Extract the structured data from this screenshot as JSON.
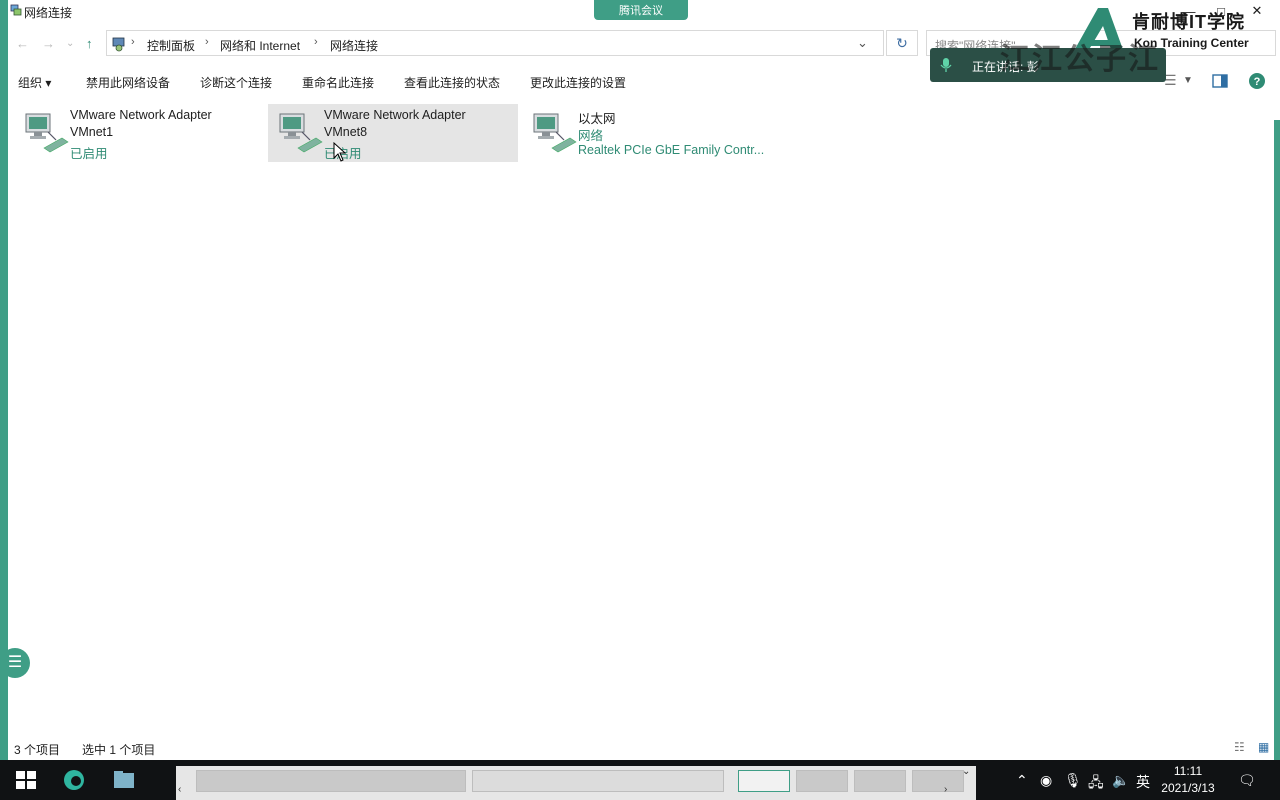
{
  "window": {
    "title": "网络连接",
    "minimize": "—",
    "maximize": "□",
    "close": "✕"
  },
  "meeting_tab": "腾讯会议",
  "nav": {
    "back": "←",
    "forward": "→",
    "recent": "⌄",
    "up": "↑"
  },
  "address": {
    "crumbs": [
      "控制面板",
      "网络和 Internet",
      "网络连接"
    ],
    "dropdown": "⌄",
    "refresh": "↻"
  },
  "search": {
    "placeholder": "搜索\"网络连接\""
  },
  "commands": [
    "组织 ▾",
    "禁用此网络设备",
    "诊断这个连接",
    "重命名此连接",
    "查看此连接的状态",
    "更改此连接的设置"
  ],
  "items": [
    {
      "name": "VMware Network Adapter",
      "name2": "VMnet1",
      "status": "已启用",
      "selected": false
    },
    {
      "name": "VMware Network Adapter",
      "name2": "VMnet8",
      "status": "已启用",
      "selected": true
    },
    {
      "name": "以太网",
      "name2": "网络",
      "status": "Realtek PCIe GbE Family Contr...",
      "selected": false
    }
  ],
  "logo": {
    "cn": "肯耐博IT学院",
    "en": "Kon Training Center"
  },
  "speaking": {
    "prefix": "正在讲话:",
    "name": "彭"
  },
  "watermark": "江江公子江",
  "statusbar": {
    "count": "3 个项目",
    "selected": "选中 1 个项目"
  },
  "taskbar": {
    "tray_lang": "英",
    "time": "11:11",
    "date": "2021/3/13"
  },
  "colors": {
    "accent": "#3f9e86",
    "link_green": "#2f8b74",
    "taskbar": "#101214"
  }
}
